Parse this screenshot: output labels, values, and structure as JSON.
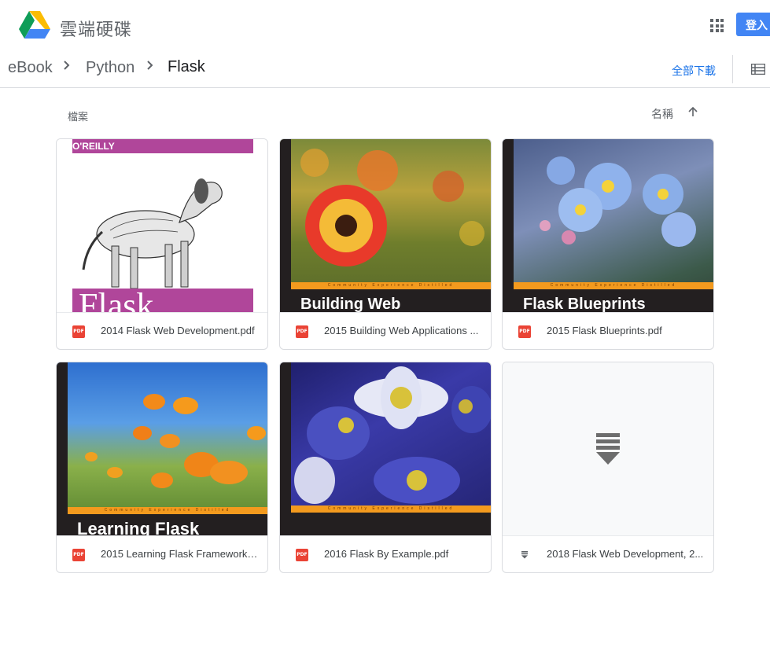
{
  "header": {
    "app_name": "雲端硬碟",
    "signin_label": "登入"
  },
  "breadcrumb": {
    "items": [
      "eBook",
      "Python",
      "Flask"
    ]
  },
  "toolbar": {
    "download_all_label": "全部下載"
  },
  "files_section": {
    "label": "檔案",
    "sort_label": "名稱",
    "sort_direction": "ascending"
  },
  "files": [
    {
      "name": "2014 Flask Web Development.pdf",
      "type": "pdf",
      "cover_text": "Flask",
      "publisher": "O'REILLY"
    },
    {
      "name": "2015 Building Web Applications ...",
      "type": "pdf",
      "cover_text": "Building Web Applications",
      "cover_strip": "Community Experience Distilled"
    },
    {
      "name": "2015 Flask Blueprints.pdf",
      "type": "pdf",
      "cover_text": "Flask Blueprints",
      "cover_strip": "Community Experience Distilled"
    },
    {
      "name": "2015 Learning Flask Framework....",
      "type": "pdf",
      "cover_text": "Learning Flask",
      "cover_strip": "Community Experience Distilled"
    },
    {
      "name": "2016 Flask By Example.pdf",
      "type": "pdf",
      "cover_strip": "Community Experience Distilled"
    },
    {
      "name": "2018 Flask Web Development, 2...",
      "type": "archive"
    }
  ],
  "colors": {
    "accent": "#4285f4",
    "link": "#1a73e8",
    "pdf_red": "#ea4335",
    "cover_orange": "#f39a1e",
    "oreilly_magenta": "#b0469a"
  }
}
